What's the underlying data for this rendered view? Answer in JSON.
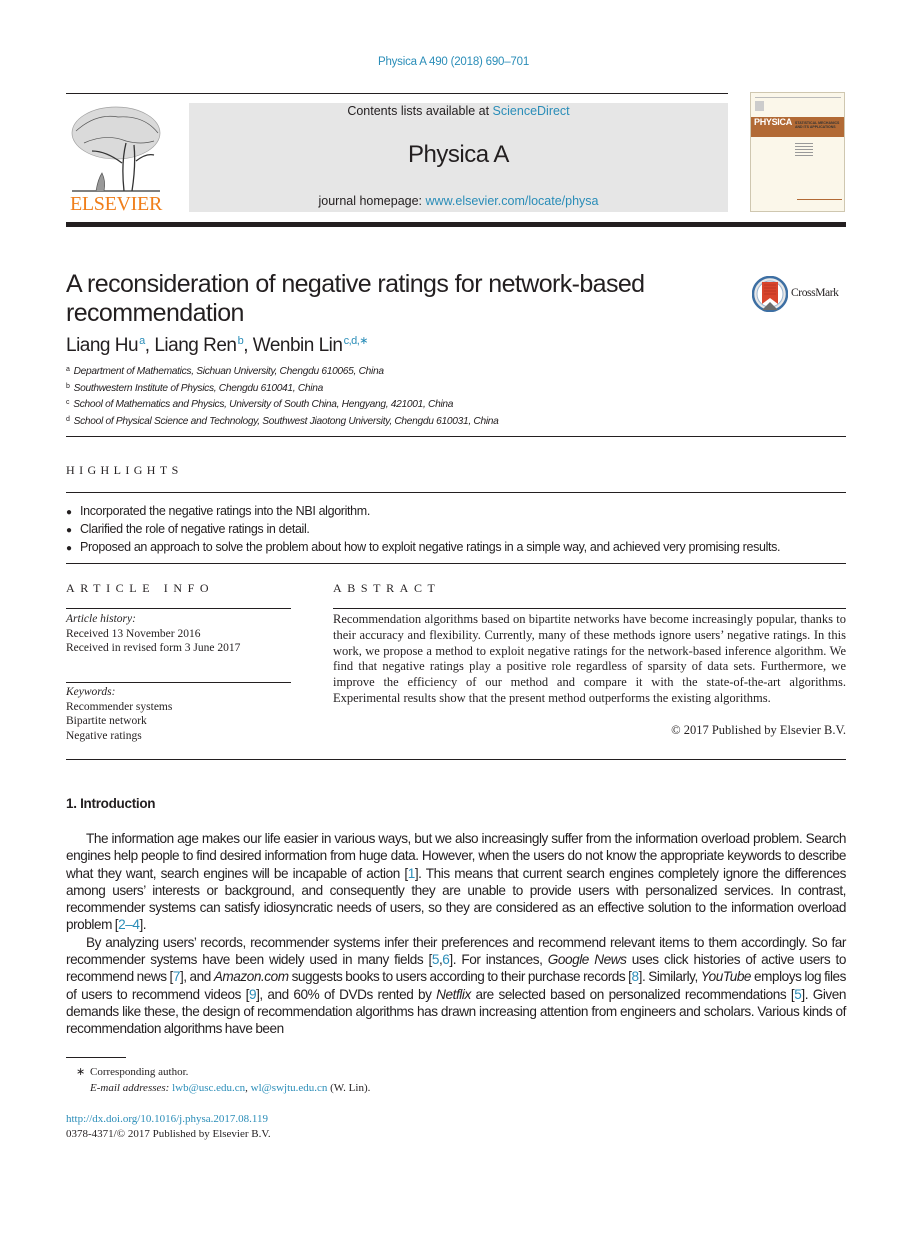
{
  "header": {
    "citation": "Physica A 490 (2018) 690–701",
    "contents_prefix": "Contents lists available at ",
    "contents_link": "ScienceDirect",
    "journal_name": "Physica A",
    "homepage_prefix": "journal homepage: ",
    "homepage_link": "www.elsevier.com/locate/physa",
    "publisher_logo": "ELSEVIER",
    "cover_title": "PHYSICA",
    "cover_subtitle": "STATISTICAL MECHANICS AND ITS APPLICATIONS",
    "brand_color": "#f07e1b",
    "link_color": "#2a8db8"
  },
  "article": {
    "title": "A reconsideration of negative ratings for network-based recommendation",
    "crossmark_label": "CrossMark",
    "authors": [
      {
        "name": "Liang Hu",
        "sup": "a"
      },
      {
        "name": "Liang Ren",
        "sup": "b"
      },
      {
        "name": "Wenbin Lin",
        "sup": "c,d,∗"
      }
    ],
    "affiliations": [
      {
        "key": "a",
        "text": "Department of Mathematics, Sichuan University, Chengdu 610065, China"
      },
      {
        "key": "b",
        "text": "Southwestern Institute of Physics, Chengdu 610041, China"
      },
      {
        "key": "c",
        "text": "School of Mathematics and Physics, University of South China, Hengyang, 421001, China"
      },
      {
        "key": "d",
        "text": "School of Physical Science and Technology, Southwest Jiaotong University, Chengdu 610031, China"
      }
    ]
  },
  "highlights": {
    "heading": "HIGHLIGHTS",
    "items": [
      "Incorporated the negative ratings into the NBI algorithm.",
      "Clarified the role of negative ratings in detail.",
      "Proposed an approach to solve the problem about how to exploit negative ratings in a simple way, and achieved very promising results."
    ]
  },
  "article_info": {
    "heading": "ARTICLE INFO",
    "history_label": "Article history:",
    "history": [
      "Received 13 November 2016",
      "Received in revised form 3 June 2017"
    ],
    "keywords_label": "Keywords:",
    "keywords": [
      "Recommender systems",
      "Bipartite network",
      "Negative ratings"
    ]
  },
  "abstract": {
    "heading": "ABSTRACT",
    "text": "Recommendation algorithms based on bipartite networks have become increasingly popular, thanks to their accuracy and flexibility. Currently, many of these methods ignore users’ negative ratings. In this work, we propose a method to exploit negative ratings for the network-based inference algorithm. We find that negative ratings play a positive role regardless of sparsity of data sets. Furthermore, we improve the efficiency of our method and compare it with the state-of-the-art algorithms. Experimental results show that the present method outperforms the existing algorithms.",
    "copyright": "© 2017 Published by Elsevier B.V."
  },
  "introduction": {
    "heading": "1.  Introduction",
    "p1": [
      {
        "t": "The information age makes our life easier in various ways, but we also increasingly suffer from the information overload problem. Search engines help people to find desired information from huge data. However, when the users do not know the appropriate keywords to describe what they want, search engines will be incapable of action ["
      },
      {
        "ref": "1"
      },
      {
        "t": "]. This means that current search engines completely ignore the differences among users’ interests or background, and consequently they are unable to provide users with personalized services. In contrast, recommender systems can satisfy idiosyncratic needs of users, so they are considered as an effective solution to the information overload problem ["
      },
      {
        "ref": "2–4"
      },
      {
        "t": "]."
      }
    ],
    "p2": [
      {
        "t": "By analyzing users’ records, recommender systems infer their preferences and recommend relevant items to them accordingly. So far recommender systems have been widely used in many fields ["
      },
      {
        "ref": "5"
      },
      {
        "t": ","
      },
      {
        "ref": "6"
      },
      {
        "t": "]. For instances, "
      },
      {
        "i": "Google News"
      },
      {
        "t": " uses click histories of active users to recommend news ["
      },
      {
        "ref": "7"
      },
      {
        "t": "], and "
      },
      {
        "i": "Amazon.com"
      },
      {
        "t": " suggests books to users according to their purchase records ["
      },
      {
        "ref": "8"
      },
      {
        "t": "]. Similarly, "
      },
      {
        "i": "YouTube"
      },
      {
        "t": " employs log files of users to recommend videos ["
      },
      {
        "ref": "9"
      },
      {
        "t": "], and 60% of DVDs rented by "
      },
      {
        "i": "Netflix"
      },
      {
        "t": " are selected based on personalized recommendations ["
      },
      {
        "ref": "5"
      },
      {
        "t": "]. Given demands like these, the design of recommendation algorithms has drawn increasing attention from engineers and scholars. Various kinds of recommendation algorithms have been"
      }
    ]
  },
  "footnotes": {
    "star": "∗",
    "corresponding": "Corresponding author.",
    "email_label": "E-mail addresses: ",
    "emails": [
      "lwb@usc.edu.cn",
      "wl@swjtu.edu.cn"
    ],
    "email_suffix": " (W. Lin).",
    "doi": "http://dx.doi.org/10.1016/j.physa.2017.08.119",
    "issn_line": "0378-4371/© 2017 Published by Elsevier B.V."
  }
}
